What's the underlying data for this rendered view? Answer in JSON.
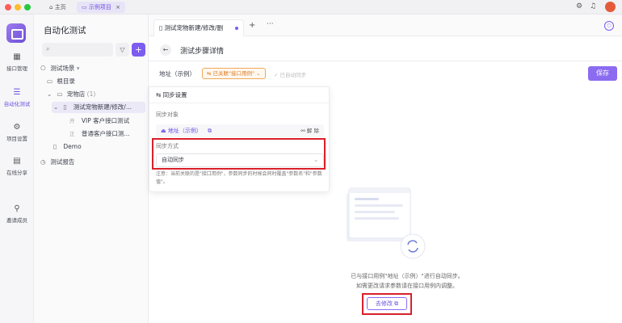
{
  "titlebar": {
    "home_tab": "主页",
    "project_tab": "示例项目",
    "close_glyph": "×",
    "colors": {
      "red": "#ff5f57",
      "yellow": "#febc2e",
      "green": "#28c840"
    }
  },
  "rail": {
    "items": [
      {
        "label": "接口管理",
        "icon": "api-icon"
      },
      {
        "label": "自动化测试",
        "icon": "automation-icon"
      },
      {
        "label": "项目设置",
        "icon": "settings-icon"
      },
      {
        "label": "在线分享",
        "icon": "share-icon"
      },
      {
        "label": "邀请成员",
        "icon": "invite-icon"
      }
    ]
  },
  "sidebar": {
    "title": "自动化测试",
    "search_placeholder": "",
    "tree": {
      "test_scenarios": "测试场景",
      "root_dir": "根目录",
      "pet_store": "宠物店",
      "pet_store_count": "(1)",
      "case_name": "测试宠物新建/修改/...",
      "step1_method": "开",
      "step1": "VIP 客户接口测试",
      "step2_method": "正",
      "step2": "普通客户接口测...",
      "demo": "Demo",
      "test_reports": "测试报告"
    }
  },
  "main": {
    "tab_label": "测试宠物新建/修改/删",
    "page_title": "测试步骤详情",
    "address_label": "地址（示例）",
    "linked_badge": "已关联\"接口用例\"",
    "auto_sync_label": "已自动同步",
    "save_button": "保存",
    "sync_panel": {
      "title": "同步设置",
      "target_label": "同步对象",
      "target_value": "地址（示例）",
      "unlink": "解 除",
      "mode_label": "同步方式",
      "mode_value": "自动同步",
      "note": "注意：当前关联的是\"接口用例\"，参数同步的时候会同时覆盖\"参数名\"和\"参数值\"。"
    },
    "empty_state": {
      "line1": "已与接口用例\"地址（示例）\"进行自动同步。",
      "line2": "如需更改请求参数请在接口用例内调整。",
      "edit_button": "去修改"
    }
  },
  "colors": {
    "accent": "#7d5cf0",
    "warning": "#e07b1f",
    "highlight": "#d9202a"
  }
}
